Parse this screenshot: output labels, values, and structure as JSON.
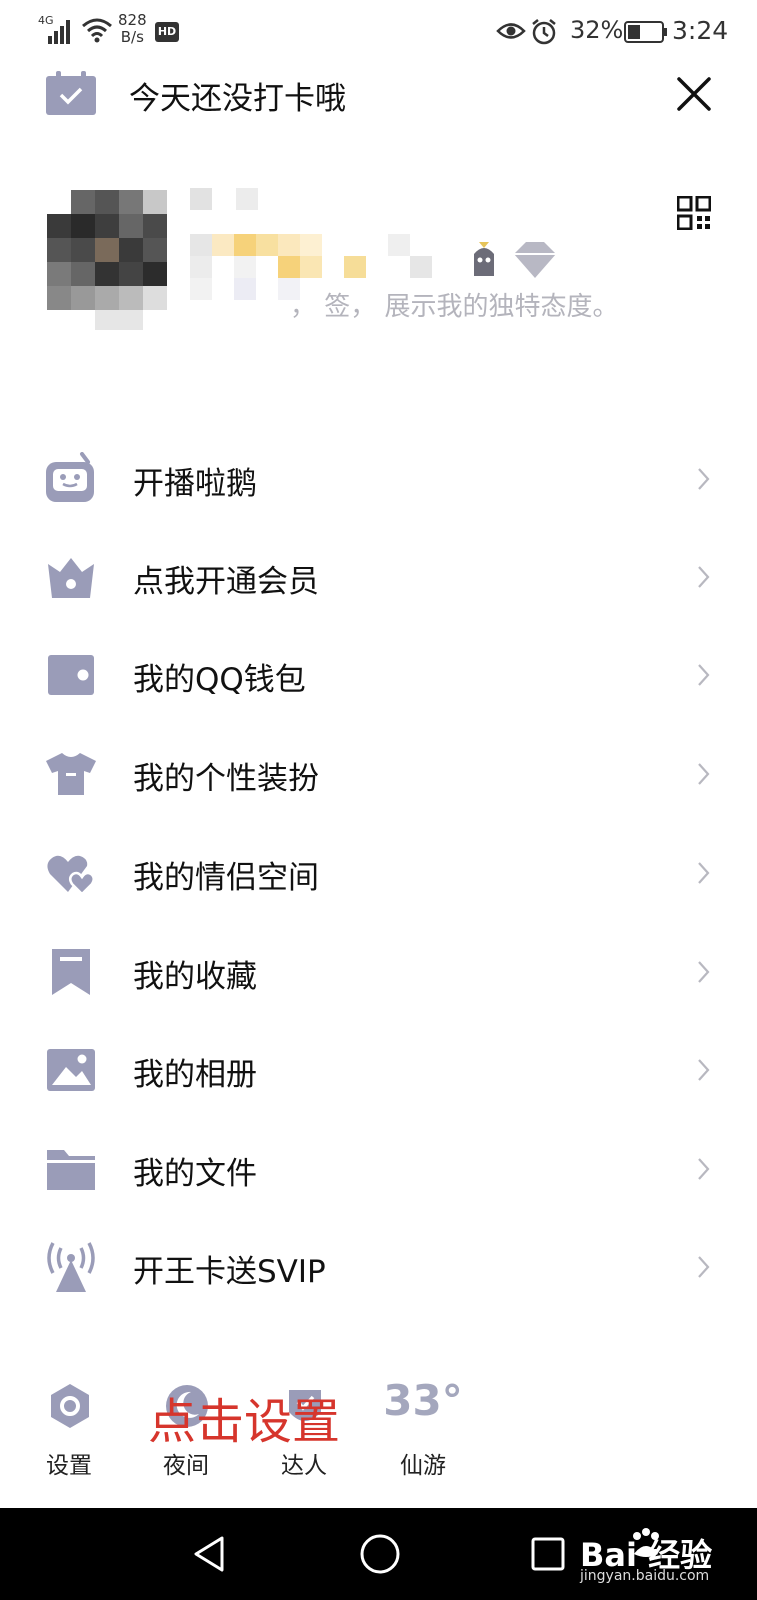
{
  "status_bar": {
    "network": "4G",
    "speed_value": "828",
    "speed_unit": "B/s",
    "hd": "HD",
    "battery_pct": "32%",
    "time": "3:24"
  },
  "header": {
    "checkin_text": "今天还没打卡哦"
  },
  "profile": {
    "signature_partial": "，  签，  展示我的独特态度。"
  },
  "menu": [
    {
      "label": "开播啦鹅",
      "icon": "tv-robot-icon"
    },
    {
      "label": "点我开通会员",
      "icon": "crown-icon"
    },
    {
      "label": "我的QQ钱包",
      "icon": "wallet-icon"
    },
    {
      "label": "我的个性装扮",
      "icon": "tshirt-icon"
    },
    {
      "label": "我的情侣空间",
      "icon": "hearts-icon"
    },
    {
      "label": "我的收藏",
      "icon": "bookmark-icon"
    },
    {
      "label": "我的相册",
      "icon": "photo-icon"
    },
    {
      "label": "我的文件",
      "icon": "folder-icon"
    },
    {
      "label": "开王卡送SVIP",
      "icon": "antenna-icon"
    }
  ],
  "quick_actions": {
    "settings": "设置",
    "night": "夜间",
    "expert": "达人",
    "weather_temp": "33°",
    "weather_city": "仙游"
  },
  "overlay": {
    "annotation": "点击设置"
  },
  "watermark": {
    "brand": "Bai 经验",
    "url": "jingyan.baidu.com"
  },
  "colors": {
    "icon": "#9a9cb8",
    "annotation": "#d6352c"
  }
}
